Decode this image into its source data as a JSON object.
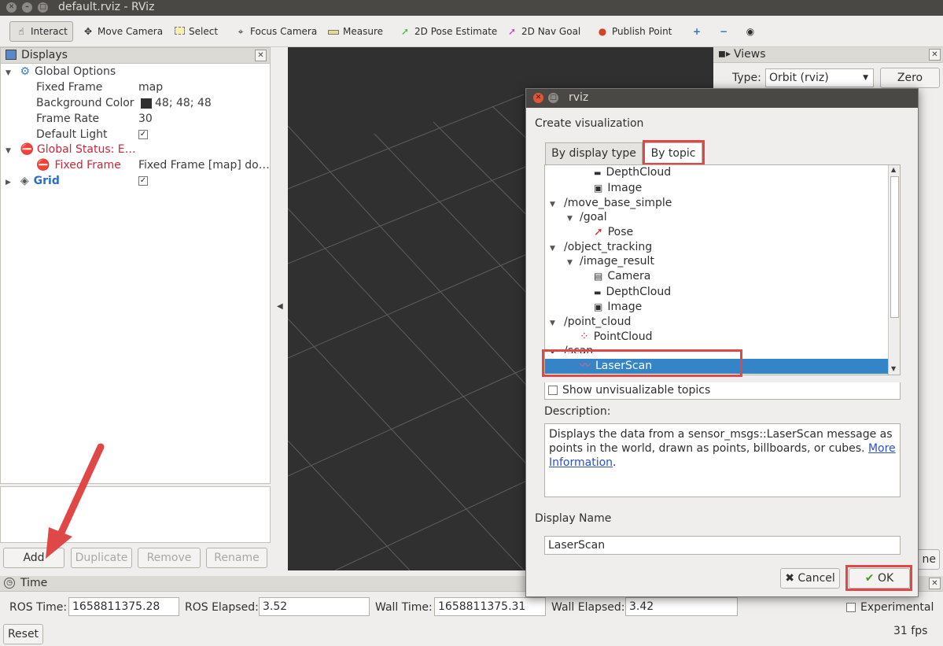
{
  "window": {
    "title": "default.rviz - RViz"
  },
  "toolbar": {
    "interact": "Interact",
    "move_camera": "Move Camera",
    "select": "Select",
    "focus_camera": "Focus Camera",
    "measure": "Measure",
    "pose_estimate": "2D Pose Estimate",
    "nav_goal": "2D Nav Goal",
    "publish_point": "Publish Point"
  },
  "displays": {
    "title": "Displays",
    "global_options": "Global Options",
    "fixed_frame_label": "Fixed Frame",
    "fixed_frame_value": "map",
    "bg_color_label": "Background Color",
    "bg_color_value": "48; 48; 48",
    "frame_rate_label": "Frame Rate",
    "frame_rate_value": "30",
    "default_light_label": "Default Light",
    "global_status": "Global Status: E…",
    "status_fixed_frame": "Fixed Frame",
    "status_fixed_frame_value": "Fixed Frame [map] do…",
    "grid": "Grid",
    "buttons": {
      "add": "Add",
      "duplicate": "Duplicate",
      "remove": "Remove",
      "rename": "Rename"
    }
  },
  "views": {
    "title": "Views",
    "type_label": "Type:",
    "type_value": "Orbit (rviz)",
    "zero": "Zero",
    "partial_button": "ne"
  },
  "time": {
    "title": "Time",
    "ros_time_label": "ROS Time:",
    "ros_time": "1658811375.28",
    "ros_elapsed_label": "ROS Elapsed:",
    "ros_elapsed": "3.52",
    "wall_time_label": "Wall Time:",
    "wall_time": "1658811375.31",
    "wall_elapsed_label": "Wall Elapsed:",
    "wall_elapsed": "3.42",
    "experimental": "Experimental",
    "reset": "Reset",
    "fps": "31 fps"
  },
  "dialog": {
    "title": "rviz",
    "heading": "Create visualization",
    "tab_display_type": "By display type",
    "tab_topic": "By topic",
    "tree": [
      {
        "label": "DepthCloud",
        "icon": "depthcloud"
      },
      {
        "label": "Image",
        "icon": "image"
      },
      {
        "label": "/move_base_simple"
      },
      {
        "label": "/goal"
      },
      {
        "label": "Pose",
        "icon": "pose"
      },
      {
        "label": "/object_tracking"
      },
      {
        "label": "/image_result"
      },
      {
        "label": "Camera",
        "icon": "camera"
      },
      {
        "label": "DepthCloud",
        "icon": "depthcloud"
      },
      {
        "label": "Image",
        "icon": "image"
      },
      {
        "label": "/point_cloud"
      },
      {
        "label": "PointCloud",
        "icon": "pointcloud"
      },
      {
        "label": "/scan"
      },
      {
        "label": "LaserScan",
        "icon": "laserscan",
        "selected": true
      }
    ],
    "show_unvisualizable": "Show unvisualizable topics",
    "description_label": "Description:",
    "description_text": "Displays the data from a sensor_msgs::LaserScan message as points in the world, drawn as points, billboards, or cubes. ",
    "description_link_1": "More",
    "description_link_2": "Information",
    "display_name_label": "Display Name",
    "display_name_value": "LaserScan",
    "cancel": "Cancel",
    "ok": "OK"
  },
  "colors": {
    "highlight": "#e04848",
    "selection": "#3584c8",
    "view_bg": "#303030"
  }
}
